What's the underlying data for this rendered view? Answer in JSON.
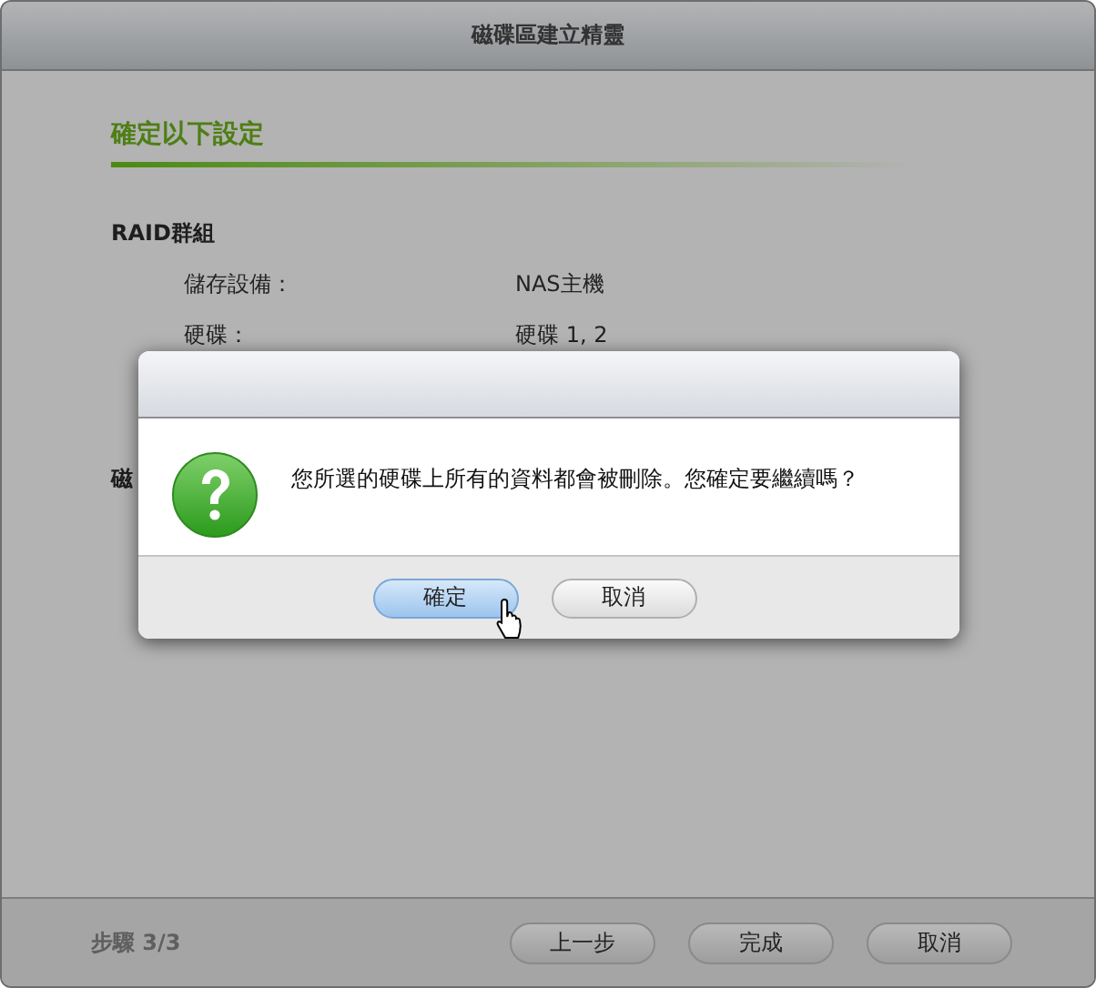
{
  "window": {
    "title": "磁碟區建立精靈"
  },
  "section_heading": "確定以下設定",
  "group": {
    "title": "RAID群組",
    "rows": [
      {
        "label": "儲存設備：",
        "value": "NAS主機"
      },
      {
        "label": "硬碟：",
        "value": "硬碟 1, 2"
      }
    ]
  },
  "next_group_title": "磁",
  "footer": {
    "step": "步驟 3/3",
    "buttons": [
      {
        "label": "上一步"
      },
      {
        "label": "完成"
      },
      {
        "label": "取消"
      }
    ]
  },
  "dialog": {
    "message": "您所選的硬碟上所有的資料都會被刪除。您確定要繼續嗎？",
    "buttons": [
      {
        "label": "確定",
        "selected": true
      },
      {
        "label": "取消",
        "selected": false
      }
    ]
  }
}
